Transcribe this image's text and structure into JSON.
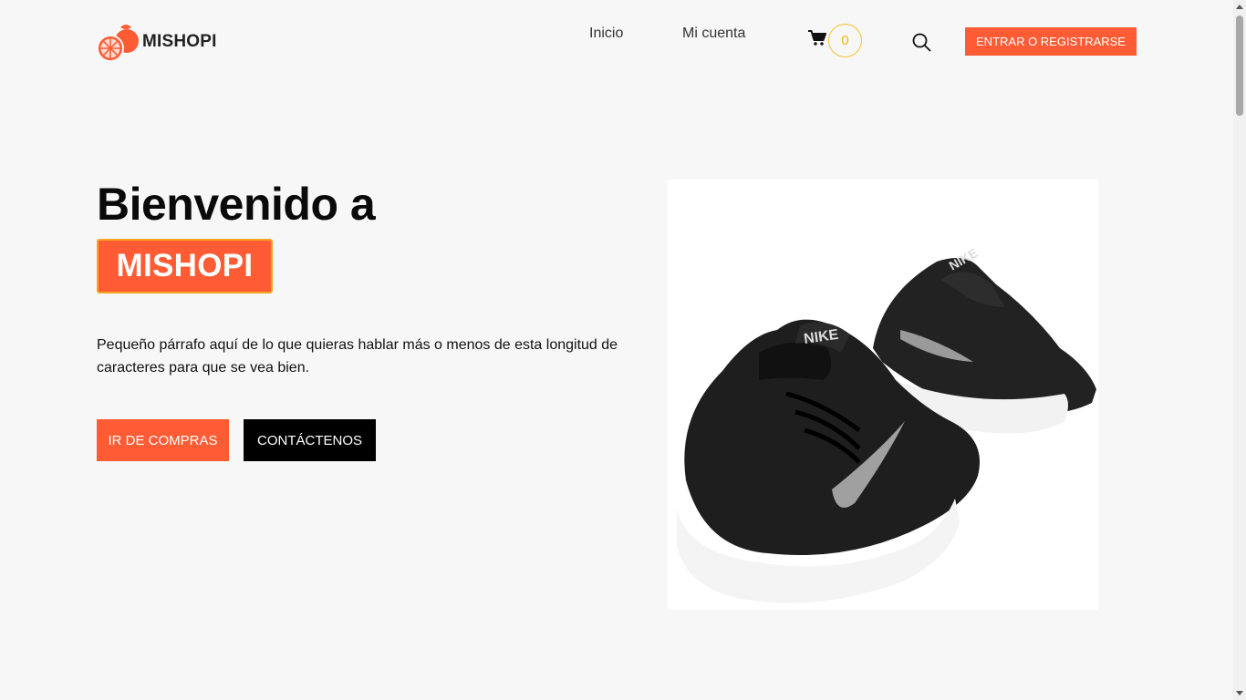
{
  "header": {
    "logo_text": "MISHOPI",
    "nav": {
      "home": "Inicio",
      "account": "Mi cuenta"
    },
    "cart_count": "0",
    "login_label": "ENTRAR O REGISTRARSE"
  },
  "hero": {
    "title": "Bienvenido a",
    "brand": "MISHOPI",
    "description": "Pequeño párrafo aquí de lo que quieras hablar más o menos de esta longitud de caracteres para que se vea bien.",
    "shop_button": "IR DE COMPRAS",
    "contact_button": "CONTÁCTENOS",
    "image_brand_text": "NIKE"
  },
  "colors": {
    "accent": "#ff5b34",
    "badge_border": "#f5a623",
    "cart_badge": "#f5c02e",
    "background": "#f7f7f7"
  },
  "icons": {
    "logo": "orange-fruit-icon",
    "cart": "shopping-cart-icon",
    "search": "search-icon"
  }
}
